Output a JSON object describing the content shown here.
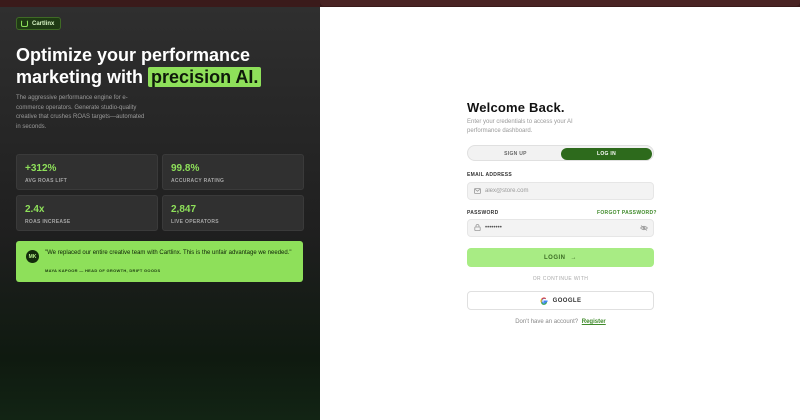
{
  "brand": {
    "name": "Cartlinx"
  },
  "hero": {
    "line1": "Optimize your performance",
    "line2": "marketing with",
    "highlight": "precision AI.",
    "description": "The aggressive performance engine for e-commerce operators. Generate studio-quality creative that crushes ROAS targets—automated in seconds."
  },
  "stats": [
    {
      "value": "+312%",
      "label": "AVG ROAS LIFT"
    },
    {
      "value": "99.8%",
      "label": "ACCURACY RATING"
    },
    {
      "value": "2.4x",
      "label": "ROAS INCREASE"
    },
    {
      "value": "2,847",
      "label": "LIVE OPERATORS"
    }
  ],
  "testimonial": {
    "initials": "MK",
    "quote": "\"We replaced our entire creative team with Cartlinx. This is the unfair advantage we needed.\"",
    "author": "MAYA KAPOOR — HEAD OF GROWTH, DRIFT GOODS"
  },
  "form": {
    "title": "Welcome Back.",
    "subtitle": "Enter your credentials to access your AI performance dashboard.",
    "tab_signup": "SIGN UP",
    "tab_login": "LOG IN",
    "email_label": "EMAIL ADDRESS",
    "email_placeholder": "alex@store.com",
    "password_label": "PASSWORD",
    "forgot": "FORGOT PASSWORD?",
    "password_value": "••••••••",
    "login_button": "LOGIN",
    "or_text": "OR CONTINUE WITH",
    "google_button": "GOOGLE",
    "register_prompt": "Don't have an account?",
    "register_link": "Register"
  },
  "colors": {
    "accent": "#8ee05a",
    "accent_dark": "#2d6a1c",
    "panel": "#303030"
  },
  "icons": {
    "brand": "brand-icon",
    "email": "mail-icon",
    "lock": "lock-icon",
    "eye": "eye-off-icon",
    "arrow": "arrow-right-icon",
    "google": "google-icon"
  }
}
